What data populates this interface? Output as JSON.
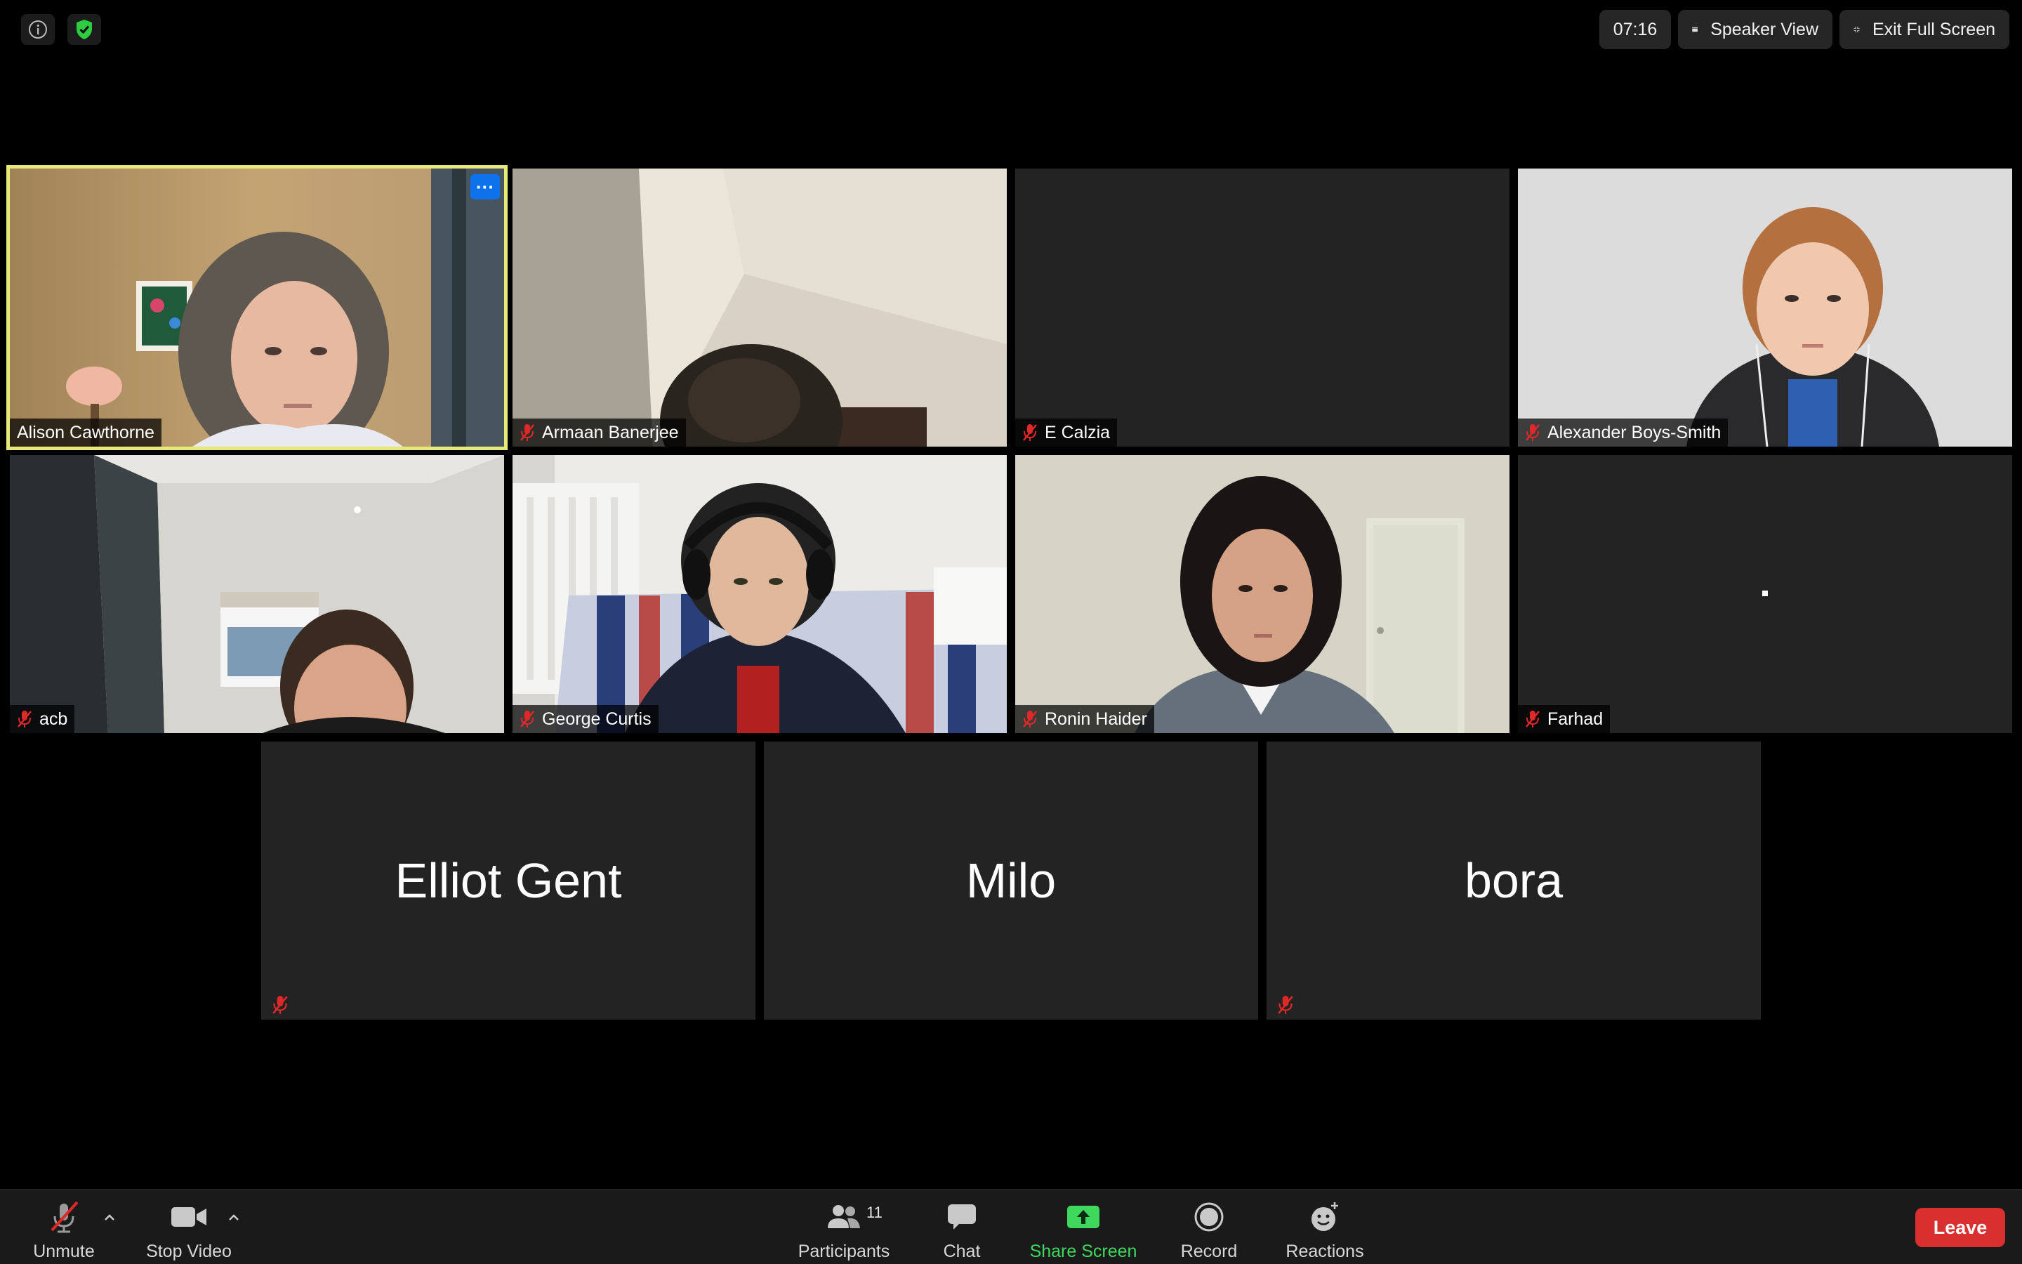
{
  "top_bar": {
    "info_icon": "info-icon",
    "security_icon": "shield-icon",
    "timer": "07:16",
    "speaker_view_label": "Speaker View",
    "exit_fullscreen_label": "Exit Full Screen",
    "security_color": "#2ecc40"
  },
  "participants": [
    {
      "name": "Alison Cawthorne",
      "muted": false,
      "video": true,
      "active_speaker": true
    },
    {
      "name": "Armaan Banerjee",
      "muted": true,
      "video": true
    },
    {
      "name": "E Calzia",
      "muted": true,
      "video": false
    },
    {
      "name": "Alexander Boys-Smith",
      "muted": true,
      "video": true
    },
    {
      "name": "acb",
      "muted": true,
      "video": true
    },
    {
      "name": "George Curtis",
      "muted": true,
      "video": true
    },
    {
      "name": "Ronin Haider",
      "muted": true,
      "video": true
    },
    {
      "name": "Farhad",
      "muted": true,
      "video": false
    },
    {
      "name": "Elliot Gent",
      "muted": true,
      "video": false
    },
    {
      "name": "Milo",
      "muted": false,
      "video": false
    },
    {
      "name": "bora",
      "muted": true,
      "video": false
    }
  ],
  "toolbar": {
    "unmute_label": "Unmute",
    "stop_video_label": "Stop Video",
    "participants_label": "Participants",
    "participants_count": "11",
    "chat_label": "Chat",
    "share_screen_label": "Share Screen",
    "record_label": "Record",
    "reactions_label": "Reactions",
    "leave_label": "Leave",
    "share_color": "#3ed95c",
    "leave_color": "#d92f2f"
  },
  "colors": {
    "active_speaker_border": "#e6e87a",
    "more_button": "#0e72ed",
    "muted_mic": "#e02828"
  }
}
